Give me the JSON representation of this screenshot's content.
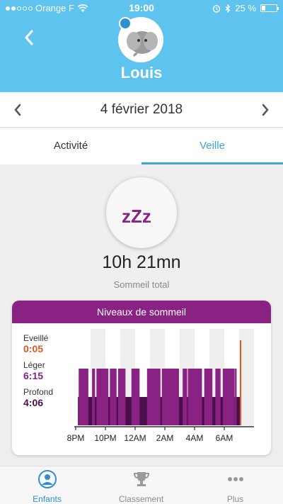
{
  "status_bar": {
    "carrier": "Orange F",
    "time": "19:00",
    "battery": "25 %",
    "battery_level": 0.25
  },
  "header": {
    "child_name": "Louis"
  },
  "date_nav": {
    "date": "4 février 2018"
  },
  "tabs": [
    {
      "label": "Activité",
      "active": false
    },
    {
      "label": "Veille",
      "active": true
    }
  ],
  "summary": {
    "icon_text": "zZz",
    "duration": "10h 21mn",
    "label": "Sommeil total"
  },
  "card": {
    "title": "Niveaux de sommeil",
    "legend": [
      {
        "label": "Eveillé",
        "value": "0:05",
        "color": "#e0571f"
      },
      {
        "label": "Léger",
        "value": "6:15",
        "color": "#8a2284"
      },
      {
        "label": "Profond",
        "value": "4:06",
        "color": "#4a0f4a"
      }
    ]
  },
  "chart_data": {
    "type": "bar",
    "x_range_hours": [
      20,
      32
    ],
    "tick_labels": [
      "8PM",
      "10PM",
      "12AM",
      "2AM",
      "4AM",
      "6AM"
    ],
    "ticks_hours": [
      20,
      22,
      24,
      26,
      28,
      30
    ],
    "levels": [
      "awake",
      "light",
      "deep"
    ],
    "colors": {
      "light": "#8a2284",
      "deep": "#4a0f4a",
      "awake": "#e0571f",
      "shade": "#eeeeee"
    },
    "light_segments": [
      [
        20.2,
        20.85
      ],
      [
        21.1,
        21.3
      ],
      [
        21.4,
        22.2
      ],
      [
        22.3,
        22.75
      ],
      [
        22.85,
        23.35
      ],
      [
        23.75,
        24.3
      ],
      [
        24.8,
        25.7
      ],
      [
        25.8,
        26.95
      ],
      [
        27.2,
        27.5
      ],
      [
        27.55,
        28.5
      ],
      [
        28.65,
        29.2
      ],
      [
        29.4,
        29.75
      ],
      [
        29.9,
        30.7
      ],
      [
        30.72,
        30.83
      ]
    ],
    "deep_span": [
      20.15,
      31.05
    ],
    "awake_events": [
      31.05
    ]
  },
  "bottom_nav": [
    {
      "label": "Enfants",
      "active": true
    },
    {
      "label": "Classement",
      "active": false
    },
    {
      "label": "Plus",
      "active": false
    }
  ]
}
